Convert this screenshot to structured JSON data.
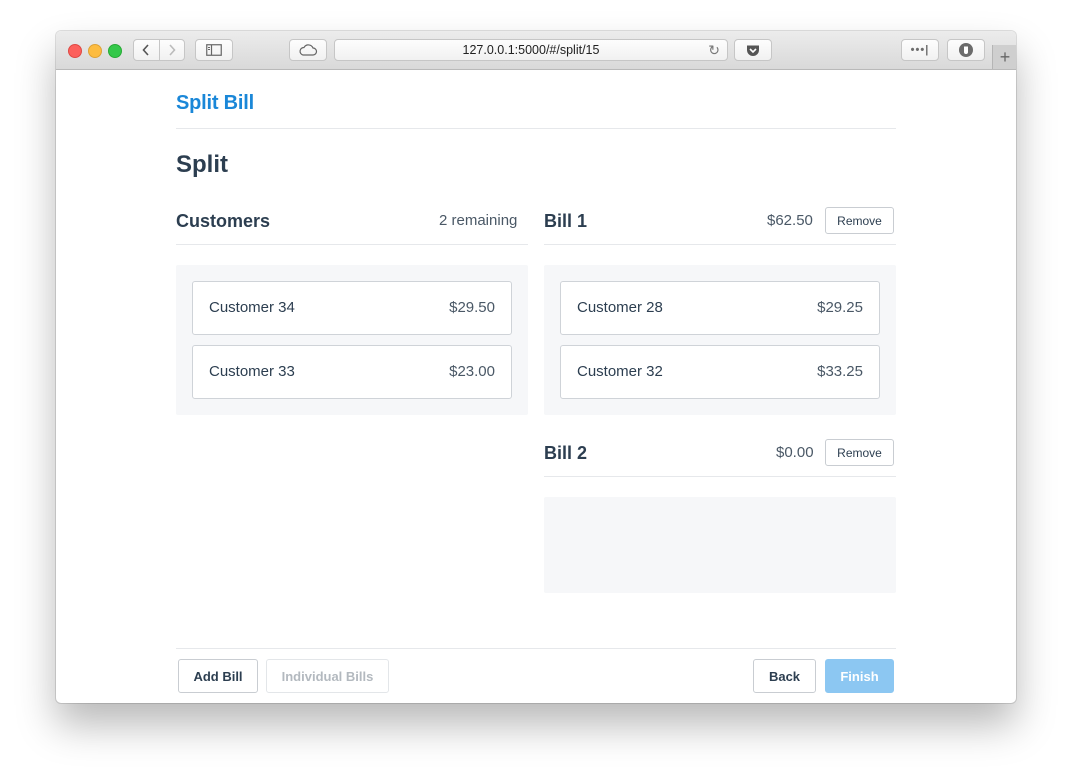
{
  "browser": {
    "url": "127.0.0.1:5000/#/split/15"
  },
  "app": {
    "brand": "Split Bill",
    "page_title": "Split"
  },
  "customers": {
    "title": "Customers",
    "remaining": "2 remaining",
    "items": [
      {
        "name": "Customer 34",
        "amount": "$29.50"
      },
      {
        "name": "Customer 33",
        "amount": "$23.00"
      }
    ]
  },
  "bills": [
    {
      "title": "Bill 1",
      "total": "$62.50",
      "remove_label": "Remove",
      "items": [
        {
          "name": "Customer 28",
          "amount": "$29.25"
        },
        {
          "name": "Customer 32",
          "amount": "$33.25"
        }
      ]
    },
    {
      "title": "Bill 2",
      "total": "$0.00",
      "remove_label": "Remove",
      "items": []
    }
  ],
  "footer": {
    "add_bill": "Add Bill",
    "individual_bills": "Individual Bills",
    "back": "Back",
    "finish": "Finish"
  },
  "colors": {
    "brand": "#1a87d8",
    "text": "#2c3e50",
    "panel": "#f6f7f9",
    "primary_disabled": "#8cc7f2"
  }
}
